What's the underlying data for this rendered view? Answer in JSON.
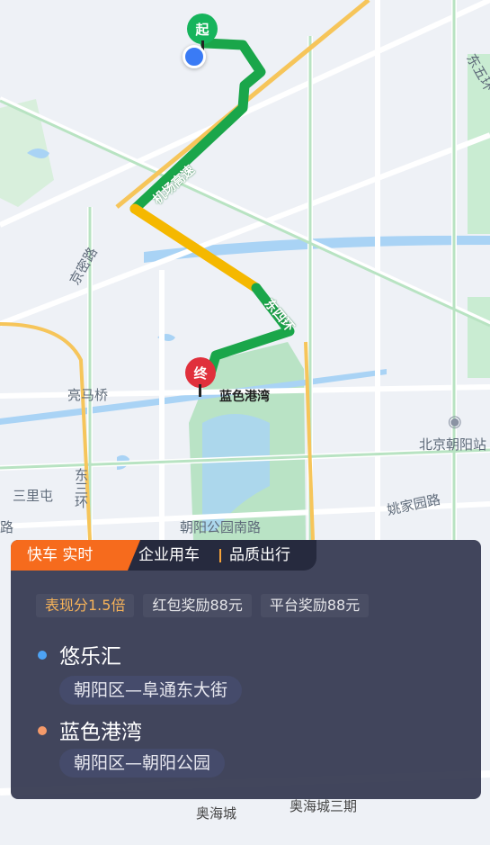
{
  "map": {
    "start_marker": "起",
    "end_marker": "终",
    "destination_label": "蓝色港湾",
    "labels": {
      "east_5th_ring": "东五环",
      "airport_expressway": "机场高速",
      "jingmi_road": "京密路",
      "east_4th_ring": "东四环",
      "liangmaqiao": "亮马桥",
      "east_3rd_ring": "东三环",
      "sanlitun": "三里屯",
      "chaoyang_park_south_road": "朝阳公园南路",
      "yaojiayuan_road": "姚家园路",
      "beijing_chaoyang": "北京朝阳站",
      "aohaicheng": "奥海城",
      "aohaicheng_3": "奥海城三期",
      "lu_left": "路"
    },
    "colors": {
      "route_green": "#1aa64a",
      "route_yellow": "#f5b800",
      "water": "#a9d3f5",
      "park": "#b9e3c5",
      "road": "#ffffff"
    }
  },
  "panel": {
    "tabs": {
      "active": "快车 实时",
      "enterprise": "企业用车",
      "quality": "品质出行"
    },
    "badges": [
      "表现分1.5倍",
      "红包奖励88元",
      "平台奖励88元"
    ],
    "origin": {
      "name": "悠乐汇",
      "address": "朝阳区—阜通东大街",
      "dot_color": "#4da3f5"
    },
    "destination": {
      "name": "蓝色港湾",
      "address": "朝阳区—朝阳公园",
      "dot_color": "#f59a6a"
    }
  }
}
